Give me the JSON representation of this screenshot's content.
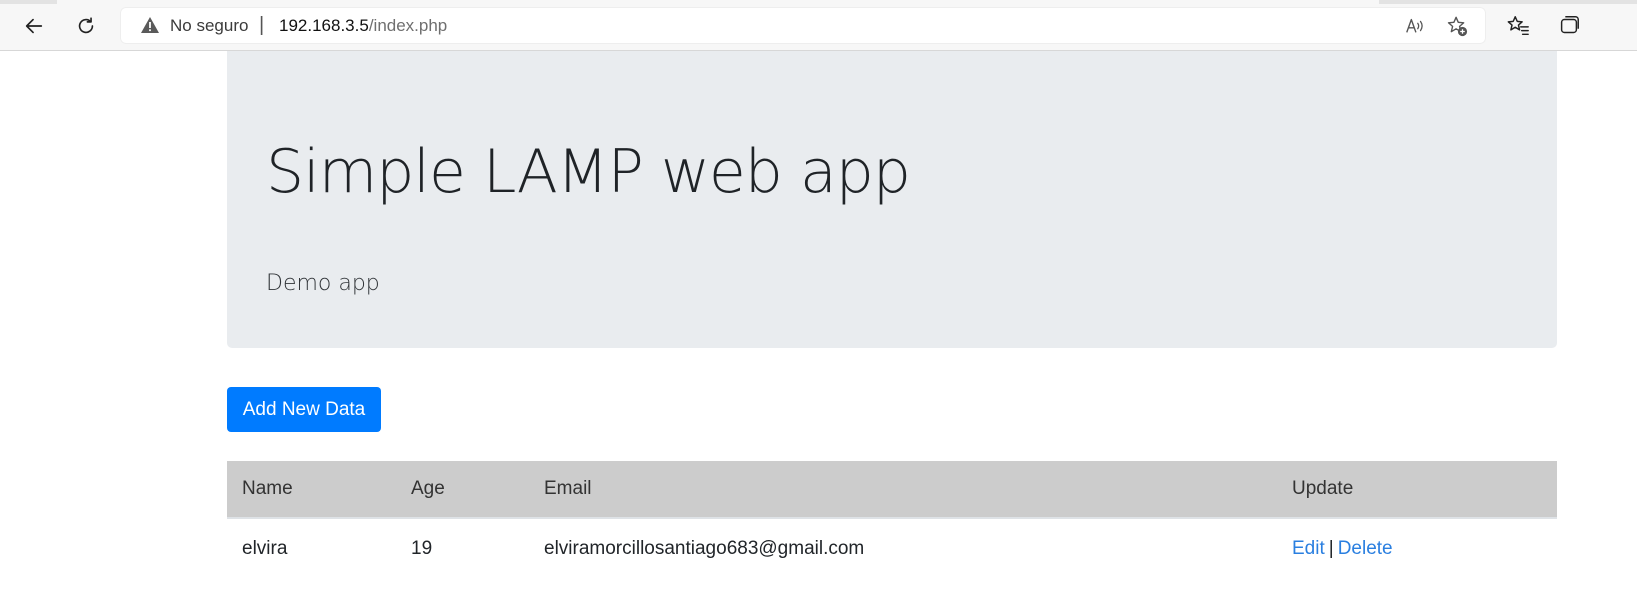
{
  "browser": {
    "security_label": "No seguro",
    "separator": "|",
    "url_host": "192.168.3.5",
    "url_path": "/index.php",
    "icons": {
      "back": "back-arrow-icon",
      "reload": "reload-icon",
      "warning": "warning-triangle-icon",
      "read_aloud": "read-aloud-icon",
      "add_favorite": "add-favorite-star-icon",
      "favorites": "favorites-icon",
      "collections": "collections-icon"
    }
  },
  "jumbotron": {
    "title": "Simple LAMP web app",
    "subtitle": "Demo app"
  },
  "actions": {
    "add_label": "Add New Data"
  },
  "table": {
    "headers": {
      "name": "Name",
      "age": "Age",
      "email": "Email",
      "update": "Update"
    },
    "rows": [
      {
        "name": "elvira",
        "age": "19",
        "email": "elviramorcillosantiago683@gmail.com",
        "edit_label": "Edit",
        "delete_label": "Delete",
        "separator": "|"
      }
    ]
  },
  "colors": {
    "primary": "#007bff",
    "link": "#2a7fe0",
    "jumbotron_bg": "#e9ecef",
    "table_header_bg": "#cccccc"
  }
}
